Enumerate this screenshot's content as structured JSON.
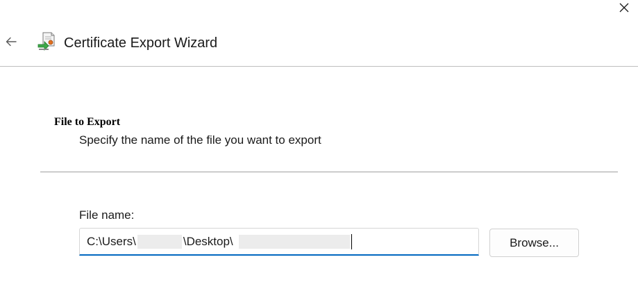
{
  "window": {
    "title": "Certificate Export Wizard"
  },
  "icons": {
    "close": "close-icon",
    "back": "back-arrow-icon",
    "wizard": "certificate-wizard-icon"
  },
  "section": {
    "heading": "File to Export",
    "description": "Specify the name of the file you want to export"
  },
  "file_field": {
    "label": "File name:",
    "value_prefix": "C:\\Users\\",
    "value_middle": "\\Desktop\\",
    "browse_label": "Browse..."
  },
  "colors": {
    "accent": "#0067c0",
    "divider": "#bdbdbd"
  }
}
